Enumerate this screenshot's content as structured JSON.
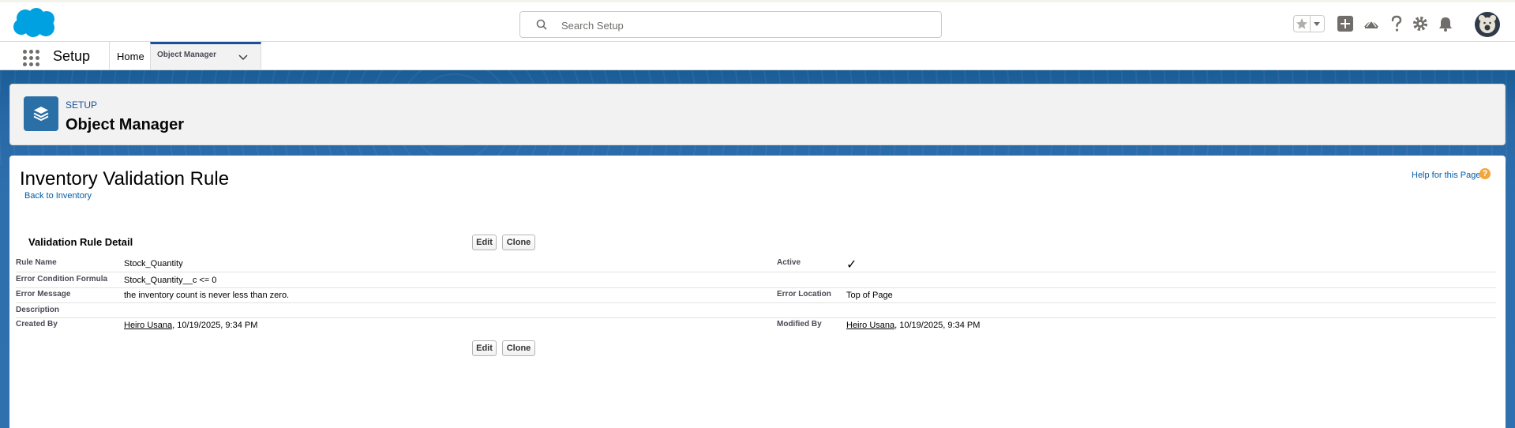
{
  "header": {
    "search_placeholder": "Search Setup"
  },
  "nav": {
    "app_name": "Setup",
    "home_label": "Home",
    "object_manager_label": "Object Manager"
  },
  "page_header": {
    "breadcrumb": "SETUP",
    "title": "Object Manager"
  },
  "content": {
    "title": "Inventory Validation Rule",
    "back_link": "Back to Inventory",
    "help_link": "Help for this Page",
    "help_icon": "?",
    "section_title": "Validation Rule Detail",
    "edit_label": "Edit",
    "clone_label": "Clone"
  },
  "detail": {
    "rule_name_label": "Rule Name",
    "rule_name_value": "Stock_Quantity",
    "active_label": "Active",
    "active_check": "✓",
    "formula_label": "Error Condition Formula",
    "formula_value": "Stock_Quantity__c <= 0",
    "error_message_label": "Error Message",
    "error_message_value": "the inventory count is never less than zero.",
    "error_location_label": "Error Location",
    "error_location_value": "Top of Page",
    "description_label": "Description",
    "created_by_label": "Created By",
    "created_by_user": "Heiro Usana",
    "created_by_date": ", 10/19/2025, 9:34 PM",
    "modified_by_label": "Modified By",
    "modified_by_user": "Heiro Usana",
    "modified_by_date": ", 10/19/2025, 9:34 PM"
  },
  "colors": {
    "brand_blue": "#1b5297",
    "link": "#015ba7",
    "help_orange": "#f2a73b"
  }
}
